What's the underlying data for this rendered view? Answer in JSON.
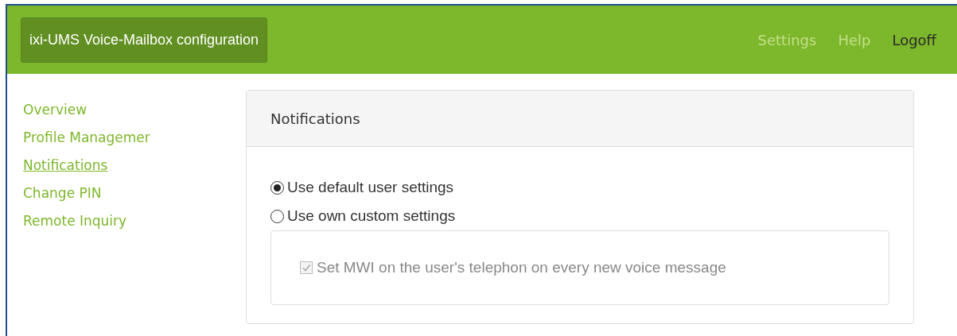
{
  "header": {
    "title": "ixi-UMS Voice-Mailbox configuration",
    "links": [
      {
        "label": "Settings",
        "dimmed": true
      },
      {
        "label": "Help",
        "dimmed": true
      },
      {
        "label": "Logoff",
        "dimmed": false
      }
    ]
  },
  "sidebar": {
    "items": [
      {
        "label": "Overview",
        "selected": false
      },
      {
        "label": "Profile Managemer",
        "selected": false
      },
      {
        "label": "Notifications",
        "selected": true
      },
      {
        "label": "Change PIN",
        "selected": false
      },
      {
        "label": "Remote Inquiry",
        "selected": false
      }
    ]
  },
  "panel": {
    "title": "Notifications",
    "options": [
      {
        "label": "Use default user settings",
        "selected": true
      },
      {
        "label": "Use own custom settings",
        "selected": false
      }
    ],
    "custom": {
      "label": "Set MWI on the user's telephon on every new voice message",
      "checked": true,
      "disabled": true
    }
  }
}
